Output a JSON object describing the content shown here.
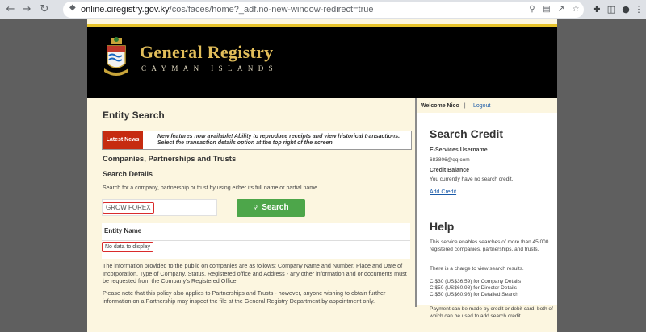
{
  "browser": {
    "url_host": "online.ciregistry.gov.ky",
    "url_path": "/cos/faces/home?_adf.no-new-window-redirect=true"
  },
  "site": {
    "brand_title": "General Registry",
    "brand_subtitle": "CAYMAN ISLANDS"
  },
  "main": {
    "heading": "Entity Search",
    "news_badge": "Latest News",
    "news_line1": "New features now available! Ability to reproduce receipts and view historical transactions.",
    "news_line2": "Select the transaction details option at the top right of the screen.",
    "section_title": "Companies, Partnerships and Trusts",
    "details_title": "Search Details",
    "help_text": "Search for a company, partnership or trust by using either its full name or partial name.",
    "search_value": "GROW FOREX",
    "search_button": "Search",
    "table_header": "Entity Name",
    "no_data": "No data to display",
    "para1": "The information provided to the public on companies are as follows: Company Name and Number, Place and Date of Incorporation, Type of Company, Status, Registered office and Address - any other information and or documents must be requested from the Company's Registered Office.",
    "para2": "Please note that this policy also applies to Partnerships and Trusts - however, anyone wishing to obtain further information on a Partnership may inspect the file at the General Registry Department by appointment only."
  },
  "side": {
    "welcome": "Welcome Nico",
    "separator": "|",
    "logout": "Logout",
    "credit_title": "Search Credit",
    "eservices_label": "E-Services Username",
    "username": "683806@qq.com",
    "balance_label": "Credit Balance",
    "balance_text": "You currently have no search credit.",
    "add_credit": "Add Credit",
    "help_title": "Help",
    "help_p1": "This service enables searches of more than 45,000 registered companies, partnerships, and trusts.",
    "help_p2": "There is a charge to view search results.",
    "fee1": "CI$30 (US$36.59) for Company Details",
    "fee2": "CI$50 (US$60.98) for Director Details",
    "fee3": "CI$50 (US$60.98) for Detailed Search",
    "help_p3": "Payment can be made by credit or debit card, both of which can be used to add search credit."
  }
}
